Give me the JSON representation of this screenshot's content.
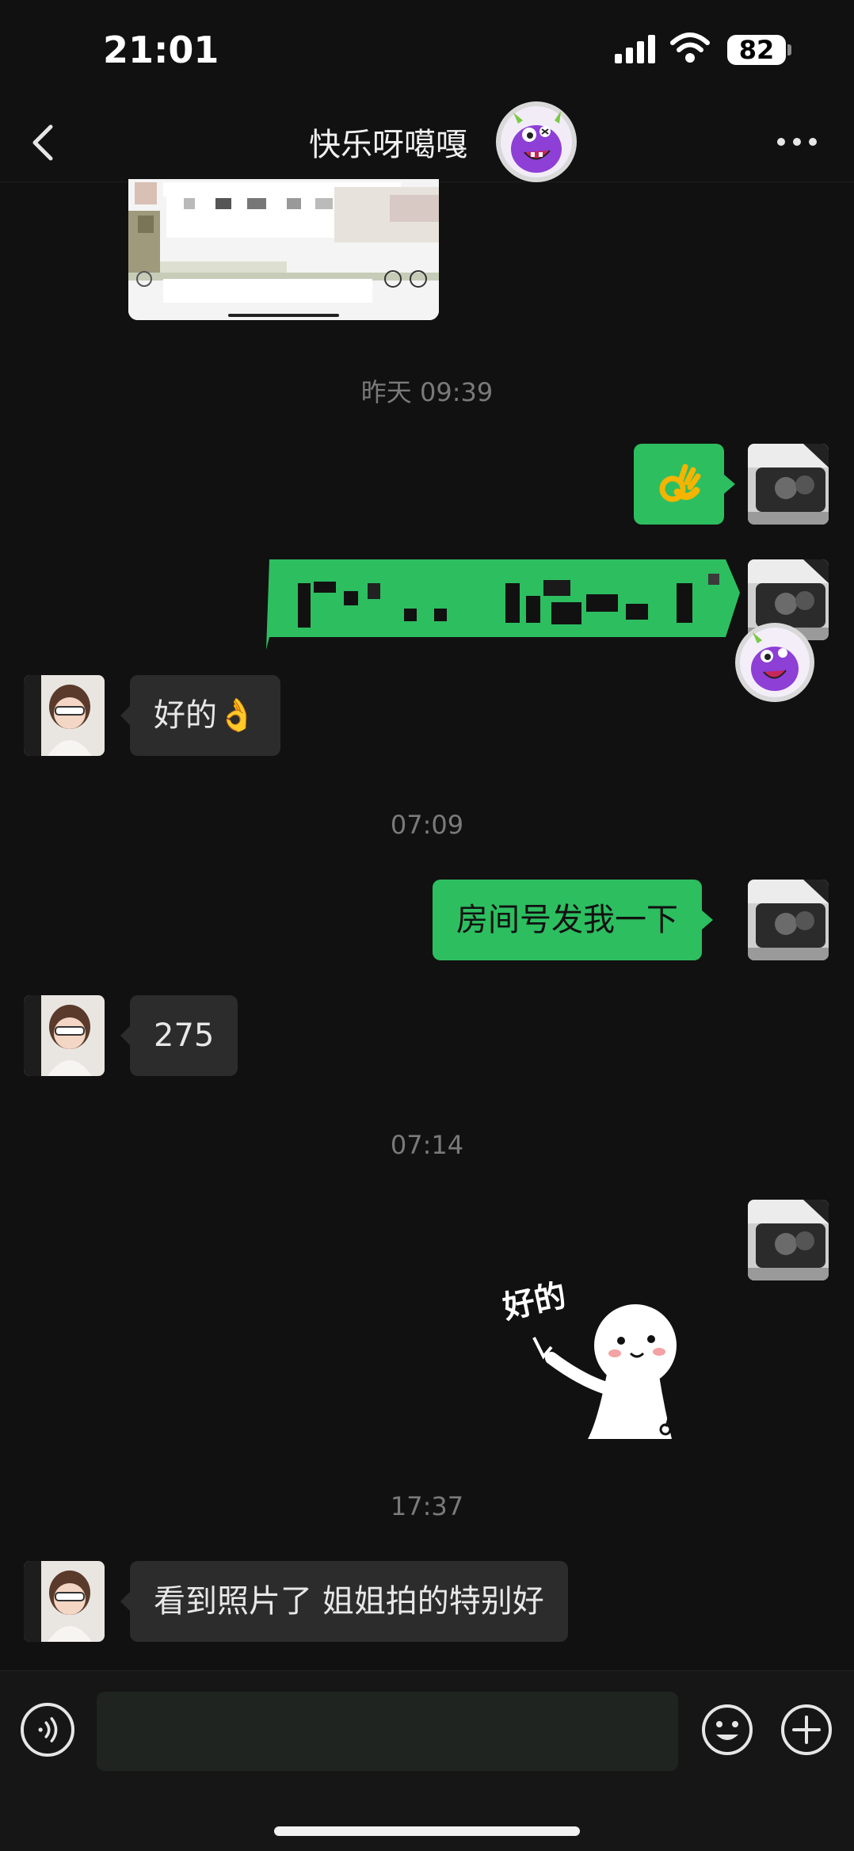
{
  "status_bar": {
    "time": "21:01",
    "battery": "82"
  },
  "header": {
    "title": "快乐呀噶嘎"
  },
  "timestamps": [
    "昨天 09:39",
    "07:09",
    "07:14",
    "17:37"
  ],
  "messages": {
    "ok_reply": "好的👌",
    "room_request": "房间号发我一下",
    "room_number": "275",
    "last": "看到照片了 姐姐拍的特别好"
  },
  "sticker": {
    "text": "好的"
  },
  "composer": {
    "placeholder": ""
  },
  "colors": {
    "accent_green": "#2dbe60",
    "background": "#111111",
    "incoming_bubble": "#2c2c2c"
  }
}
